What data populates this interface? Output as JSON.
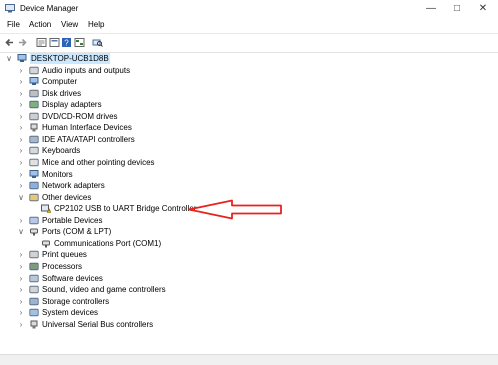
{
  "window": {
    "title": "Device Manager"
  },
  "menu": [
    "File",
    "Action",
    "View",
    "Help"
  ],
  "tree": {
    "root": "DESKTOP-UCB1D8B",
    "categories": [
      {
        "label": "Audio inputs and outputs",
        "icon": "speaker-icon"
      },
      {
        "label": "Computer",
        "icon": "computer-icon"
      },
      {
        "label": "Disk drives",
        "icon": "disk-drive-icon"
      },
      {
        "label": "Display adapters",
        "icon": "display-adapter-icon"
      },
      {
        "label": "DVD/CD-ROM drives",
        "icon": "dvd-drive-icon"
      },
      {
        "label": "Human Interface Devices",
        "icon": "hid-icon"
      },
      {
        "label": "IDE ATA/ATAPI controllers",
        "icon": "ide-controller-icon"
      },
      {
        "label": "Keyboards",
        "icon": "keyboard-icon"
      },
      {
        "label": "Mice and other pointing devices",
        "icon": "mouse-icon"
      },
      {
        "label": "Monitors",
        "icon": "monitor-icon"
      },
      {
        "label": "Network adapters",
        "icon": "network-adapter-icon"
      },
      {
        "label": "Other devices",
        "icon": "other-devices-icon"
      },
      {
        "label": "CP2102 USB to UART Bridge Controller",
        "icon": "warning-device-icon"
      },
      {
        "label": "Portable Devices",
        "icon": "portable-device-icon"
      },
      {
        "label": "Ports (COM & LPT)",
        "icon": "port-icon"
      },
      {
        "label": "Communications Port (COM1)",
        "icon": "port-icon"
      },
      {
        "label": "Print queues",
        "icon": "printer-icon"
      },
      {
        "label": "Processors",
        "icon": "processor-icon"
      },
      {
        "label": "Software devices",
        "icon": "software-device-icon"
      },
      {
        "label": "Sound, video and game controllers",
        "icon": "sound-icon"
      },
      {
        "label": "Storage controllers",
        "icon": "storage-controller-icon"
      },
      {
        "label": "System devices",
        "icon": "system-device-icon"
      },
      {
        "label": "Universal Serial Bus controllers",
        "icon": "usb-icon"
      }
    ]
  },
  "colors": {
    "annotation_arrow": "#e8231e",
    "warning": "#f5c400",
    "selection": "#cce8ff"
  }
}
